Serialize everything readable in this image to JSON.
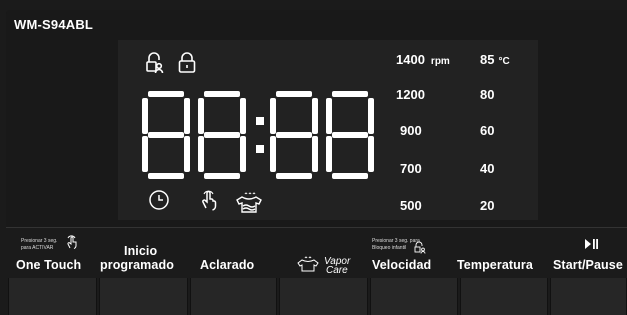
{
  "model": "WM-S94ABL",
  "display": {
    "digits": "88:88",
    "spin": {
      "unit": "rpm",
      "values": [
        "1400",
        "1200",
        "900",
        "700",
        "500"
      ]
    },
    "temperature": {
      "unit": "°C",
      "values": [
        "85",
        "80",
        "60",
        "40",
        "20"
      ]
    },
    "icons": [
      "child-lock-icon",
      "door-lock-icon",
      "clock-icon",
      "touch-icon",
      "steam-shirt-icon"
    ]
  },
  "buttons": {
    "one_touch": {
      "label": "One Touch",
      "hint_1": "Presionar 3 seg.",
      "hint_2": "para ACTIVAR"
    },
    "delay": {
      "label_1": "Inicio",
      "label_2": "programado"
    },
    "rinse": {
      "label": "Aclarado"
    },
    "vapor": {
      "label_1": "Vapor",
      "label_2": "Care"
    },
    "spin": {
      "label": "Velocidad",
      "hint_1": "Presionar 3 seg. para",
      "hint_2": "Bloqueo infantil"
    },
    "temperature": {
      "label": "Temperatura"
    },
    "start": {
      "label": "Start/Pause"
    }
  },
  "colors": {
    "panel": "#1b1b1b",
    "lcd": "#222222",
    "segment": "#ffffff",
    "key": "#262626"
  }
}
